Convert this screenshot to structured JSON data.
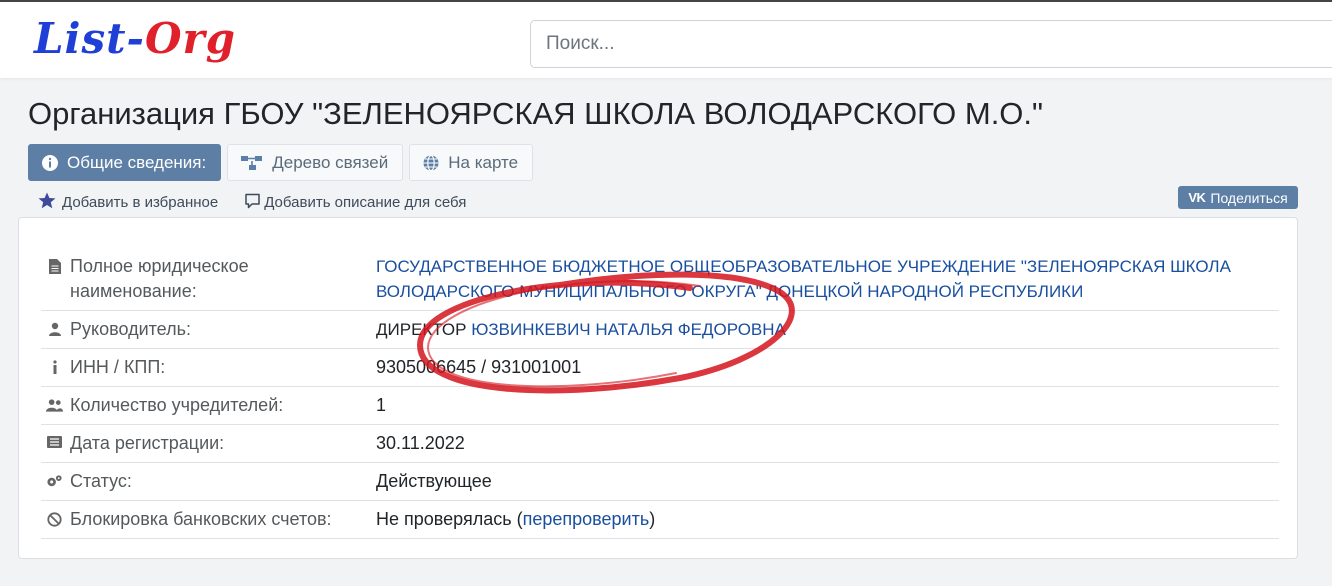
{
  "logo": {
    "part1": "List-",
    "part2": "Org"
  },
  "search": {
    "placeholder": "Поиск..."
  },
  "page": {
    "title": "Организация ГБОУ \"ЗЕЛЕНОЯРСКАЯ ШКОЛА ВОЛОДАРСКОГО М.О.\""
  },
  "tabs": [
    {
      "label": "Общие сведения:",
      "icon": "info-icon",
      "active": true
    },
    {
      "label": "Дерево связей",
      "icon": "tree-icon",
      "active": false
    },
    {
      "label": "На карте",
      "icon": "globe-icon",
      "active": false
    }
  ],
  "actions": {
    "favorite": "Добавить в избранное",
    "description": "Добавить описание для себя",
    "share_vk": "VK",
    "share": "Поделиться"
  },
  "info": {
    "full_name_label": "Полное юридическое наименование:",
    "full_name_value": "ГОСУДАРСТВЕННОЕ БЮДЖЕТНОЕ ОБЩЕОБРАЗОВАТЕЛЬНОЕ УЧРЕЖДЕНИЕ \"ЗЕЛЕНОЯРСКАЯ ШКОЛА ВОЛОДАРСКОГО МУНИЦИПАЛЬНОГО ОКРУГА\" ДОНЕЦКОЙ НАРОДНОЙ РЕСПУБЛИКИ",
    "head_label": "Руководитель:",
    "head_position": "ДИРЕКТОР",
    "head_name": "ЮЗВИНКЕВИЧ НАТАЛЬЯ ФЕДОРОВНА",
    "inn_label": "ИНН / КПП:",
    "inn_value": "9305006645 / 931001001",
    "founders_label": "Количество учредителей:",
    "founders_value": "1",
    "reg_date_label": "Дата регистрации:",
    "reg_date_value": "30.11.2022",
    "status_label": "Статус:",
    "status_value": "Действующее",
    "block_label": "Блокировка банковских счетов:",
    "block_value": "Не проверялась (",
    "block_link": "перепроверить",
    "block_close": ")"
  },
  "colors": {
    "accent": "#5d7fa6",
    "link": "#1a4fa0",
    "status_active": "#1f7a1f",
    "annotation": "#d4141c"
  }
}
